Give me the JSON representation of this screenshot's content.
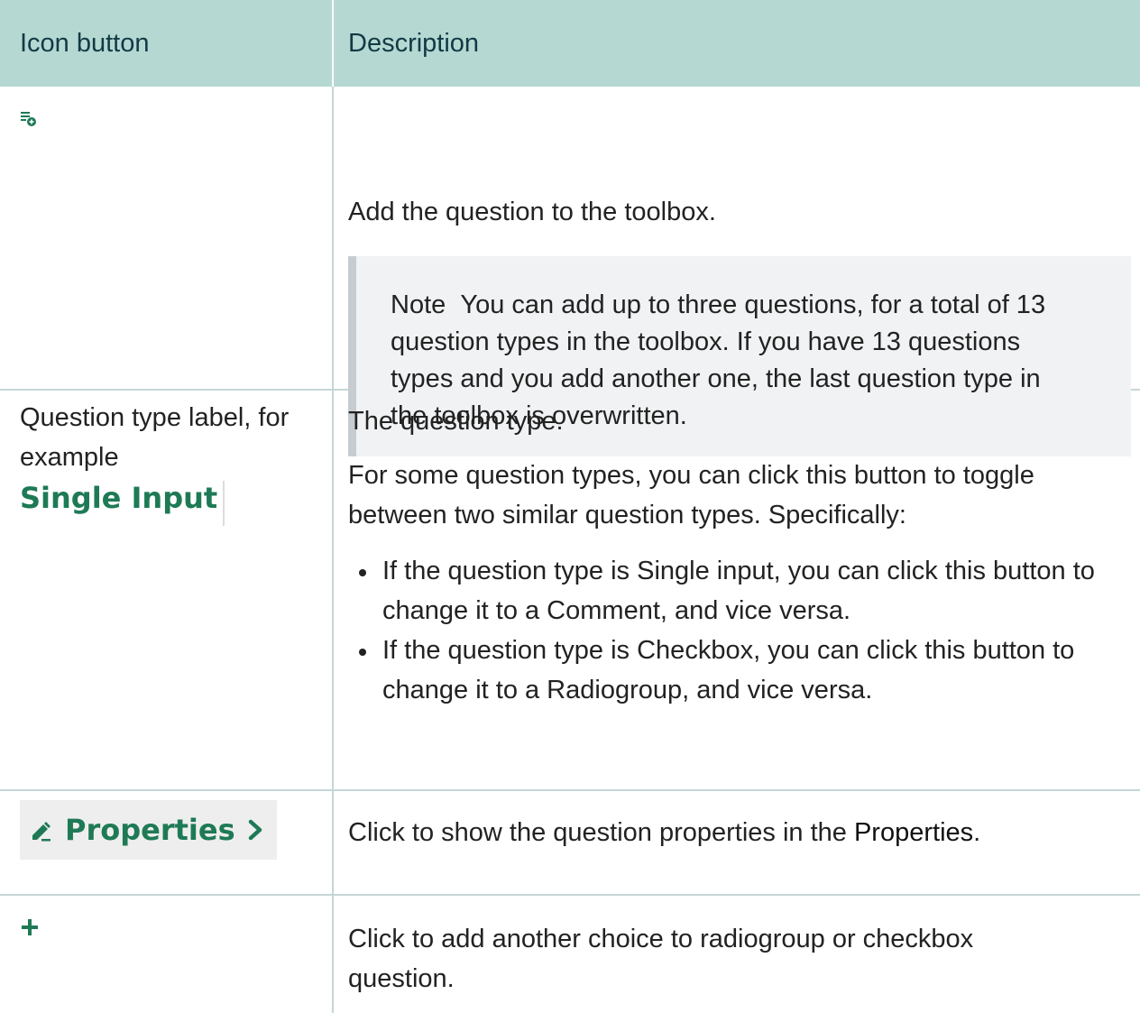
{
  "table": {
    "headers": {
      "icon_button": "Icon button",
      "description": "Description"
    },
    "row_add_question": {
      "icon": "list-add-icon",
      "description": "Add the question to the toolbox.",
      "note_label": "Note",
      "note_text": "You can add up to three questions, for a total of 13 question types in the toolbox. If you have 13 questions types and you add another one, the last question type in the toolbox is overwritten."
    },
    "row_question_type": {
      "label": "Question type label, for example",
      "example_chip": "Single Input",
      "description_1": "The question type.",
      "description_2": "For some question types, you can click this button to toggle between two similar question types. Specifically:",
      "bullets": [
        "If the question type is Single input, you can click this button to change it to a Comment, and vice versa.",
        "If the question type is Checkbox, you can click this button to change it to a Radiogroup, and vice versa."
      ]
    },
    "row_properties": {
      "icon": "pencil-icon",
      "chip_label": "Properties",
      "chevron": "chevron-right-icon",
      "description_prefix": "Click to show the question properties in the ",
      "description_bold": "Properties",
      "description_suffix": "."
    },
    "row_add_choice": {
      "icon": "plus-icon",
      "description": "Click to add another choice to radiogroup or checkbox question."
    }
  },
  "colors": {
    "header_bg": "#b5d8d2",
    "header_text": "#123a45",
    "accent_green": "#1e7a55",
    "border": "#c6d6d6",
    "note_bg": "#f0f2f3",
    "note_bar": "#c7ccd1"
  }
}
